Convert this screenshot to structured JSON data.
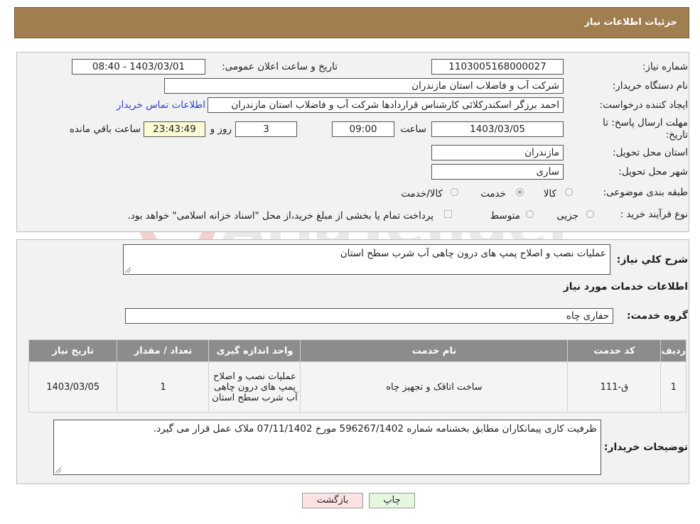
{
  "header": {
    "title": "جزئیات اطلاعات نیاز"
  },
  "details": {
    "need_number_label": "شماره نیاز:",
    "need_number": "1103005168000027",
    "announce_label": "تاریخ و ساعت اعلان عمومی:",
    "announce_value": "1403/03/01 - 08:40",
    "buyer_org_label": "نام دستگاه خریدار:",
    "buyer_org": "شرکت آب و فاضلاب استان مازندران",
    "creator_label": "ایجاد کننده درخواست:",
    "creator": "احمد برزگر اسکندرکلائی کارشناس قراردادها شرکت آب و فاضلاب استان مازندران",
    "contact_link": "اطلاعات تماس خریدار",
    "deadline_label_1": "مهلت ارسال پاسخ: تا",
    "deadline_label_2": "تاریخ:",
    "deadline_date": "1403/03/05",
    "time_label": "ساعت",
    "deadline_time": "09:00",
    "days": "3",
    "days_label": "روز و",
    "remaining_time": "23:43:49",
    "remaining_label": "ساعت باقي مانده",
    "province_label": "استان محل تحویل:",
    "province": "مازندران",
    "city_label": "شهر محل تحویل:",
    "city": "ساری",
    "category_label": "طبقه بندی موضوعی:",
    "category_options": [
      "کالا",
      "خدمت",
      "کالا/خدمت"
    ],
    "category_selected": "خدمت",
    "process_label": "نوع فرآیند خرید :",
    "process_options": [
      "جزیی",
      "متوسط"
    ],
    "payment_note": "پرداخت تمام یا بخشی از مبلغ خرید،از محل \"اسناد خزانه اسلامی\" خواهد بود."
  },
  "summary": {
    "label": "شرح کلي نياز:",
    "text": "عملیات نصب و اصلاح پمپ های درون چاهی آب شرب سطح استان",
    "services_title": "اطلاعات خدمات مورد نياز",
    "group_label": "گروه خدمت:",
    "group_value": "حفاری چاه"
  },
  "table": {
    "headers": [
      "ردیف",
      "کد خدمت",
      "نام خدمت",
      "واحد اندازه گیری",
      "تعداد / مقدار",
      "تاریخ نیاز"
    ],
    "rows": [
      [
        "1",
        "ق-111",
        "ساخت اتاقک و تجهیز چاه",
        "عملیات نصب و اصلاح پمپ های درون چاهی آب شرب سطح استان",
        "1",
        "1403/03/05"
      ]
    ]
  },
  "buyer_notes": {
    "label": "توضیحات خریدار:",
    "text": "ظرفیت کاری پیمانکاران مطابق بخشنامه شماره 596267/1402 مورخ 07/11/1402 ملاک عمل قرار می گیرد."
  },
  "buttons": {
    "print": "چاپ",
    "back": "بازگشت"
  },
  "watermark_text": "AriaTender.neT",
  "colors": {
    "header": "#a07e4f",
    "table_header": "#8c8c8c",
    "back_button": "#fbe3e3",
    "print_button": "#e6f7e0",
    "link": "#2d41c9"
  }
}
